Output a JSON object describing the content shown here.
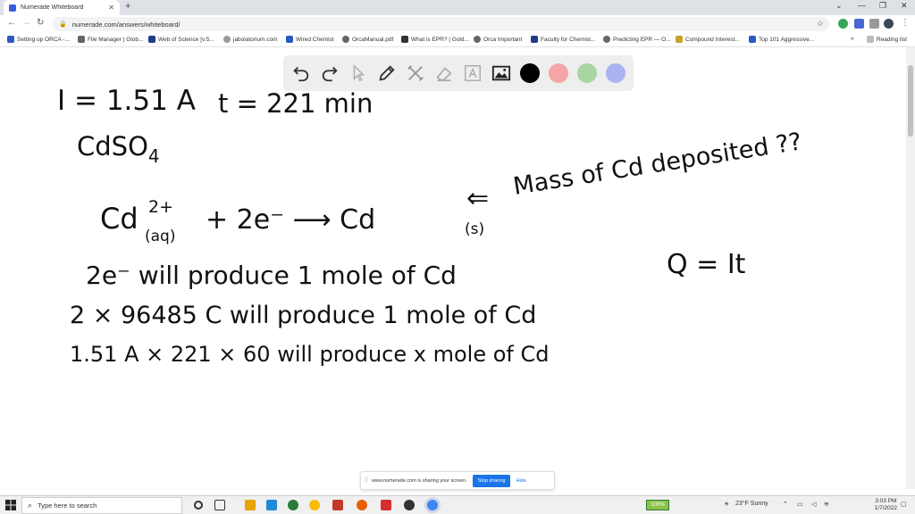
{
  "browser": {
    "tab_title": "Numerade Whiteboard",
    "url": "numerade.com/answers/whiteboard/",
    "bookmarks": [
      "Setting up ORCA -...",
      "File Manager | Glob...",
      "Web of Science [v.5...",
      "jabolatorium.com",
      "Wired Chemist",
      "OrcaManual.pdf",
      "What is EPR? | Gold...",
      "Orca Important",
      "Faculty for Chemist...",
      "Predicting EPR — O...",
      "Compound Interest...",
      "Top 101 Aggressive..."
    ],
    "reading_list": "Reading list"
  },
  "whiteboard": {
    "colors": {
      "black": "#000000",
      "red": "#f4a6a6",
      "green": "#a8d5a2",
      "blue": "#a9b4f0"
    },
    "lines": {
      "current": "I = 1.51 A",
      "time": "t = 221 min",
      "compound": "CdSO",
      "compound_sub": "4",
      "reaction_cd": "Cd",
      "reaction_charge": "2+",
      "reaction_state": "(aq)",
      "reaction_rest": "+ 2e⁻ ⟶ Cd",
      "product_state": "(s)",
      "question_arrow": "⇐",
      "question": "Mass of Cd deposited ??",
      "formula": "Q = It",
      "step1": "2e⁻  will produce 1 mole of Cd",
      "step2": "2 × 96485 C  will produce 1 mole of Cd",
      "step3": "1.51 A × 221 × 60  will produce x mole of Cd"
    }
  },
  "sharebar": {
    "message": "www.numerade.com is sharing your screen.",
    "stop": "Stop sharing",
    "hide": "Hide"
  },
  "taskbar": {
    "search_placeholder": "Type here to search",
    "battery": "100%",
    "weather": "23°F Sunny",
    "time": "3:03 PM",
    "date": "1/7/2022"
  }
}
